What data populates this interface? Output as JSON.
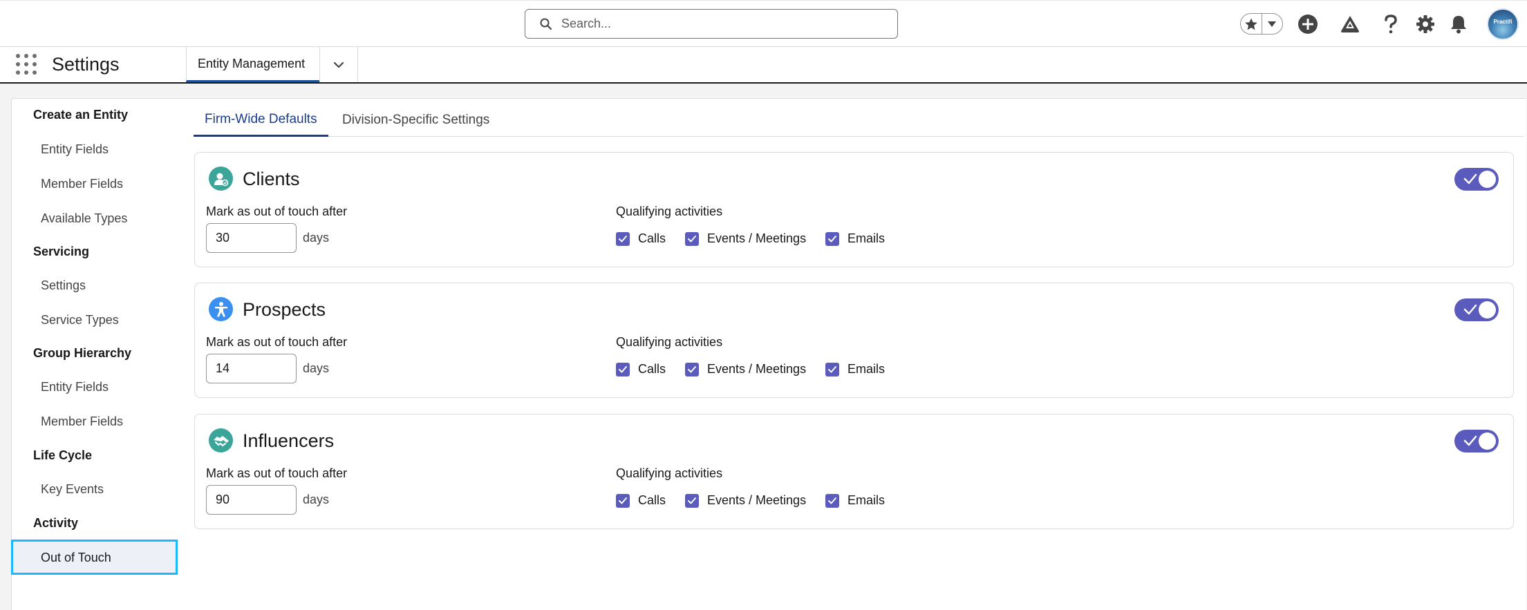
{
  "header": {
    "search_placeholder": "Search...",
    "avatar_text": "Practifi"
  },
  "app_nav": {
    "app_name": "Settings",
    "tab_label": "Entity Management"
  },
  "sidebar": {
    "sections": [
      {
        "label": "Create an Entity",
        "items": [
          "Entity Fields",
          "Member Fields",
          "Available Types"
        ]
      },
      {
        "label": "Servicing",
        "items": [
          "Settings",
          "Service Types"
        ]
      },
      {
        "label": "Group Hierarchy",
        "items": [
          "Entity Fields",
          "Member Fields"
        ]
      },
      {
        "label": "Life Cycle",
        "items": [
          "Key Events"
        ]
      },
      {
        "label": "Activity",
        "items": [
          "Out of Touch"
        ]
      }
    ],
    "active_item": "Out of Touch"
  },
  "tabs": {
    "firm_wide": "Firm-Wide Defaults",
    "division": "Division-Specific Settings",
    "active": "Firm-Wide Defaults"
  },
  "labels": {
    "mark_after": "Mark as out of touch after",
    "days": "days",
    "qualifying": "Qualifying activities",
    "calls": "Calls",
    "events": "Events / Meetings",
    "emails": "Emails"
  },
  "sections": [
    {
      "title": "Clients",
      "days": "30",
      "enabled": true,
      "calls": true,
      "events": true,
      "emails": true,
      "icon": "client-icon",
      "icon_color": "#3ba59a"
    },
    {
      "title": "Prospects",
      "days": "14",
      "enabled": true,
      "calls": true,
      "events": true,
      "emails": true,
      "icon": "prospect-icon",
      "icon_color": "#3b8ff0"
    },
    {
      "title": "Influencers",
      "days": "90",
      "enabled": true,
      "calls": true,
      "events": true,
      "emails": true,
      "icon": "handshake-icon",
      "icon_color": "#3ba59a"
    }
  ],
  "colors": {
    "accent": "#5a5bbd",
    "tab_active": "#1b3c8a",
    "selection_outline": "#1ab9ff"
  }
}
